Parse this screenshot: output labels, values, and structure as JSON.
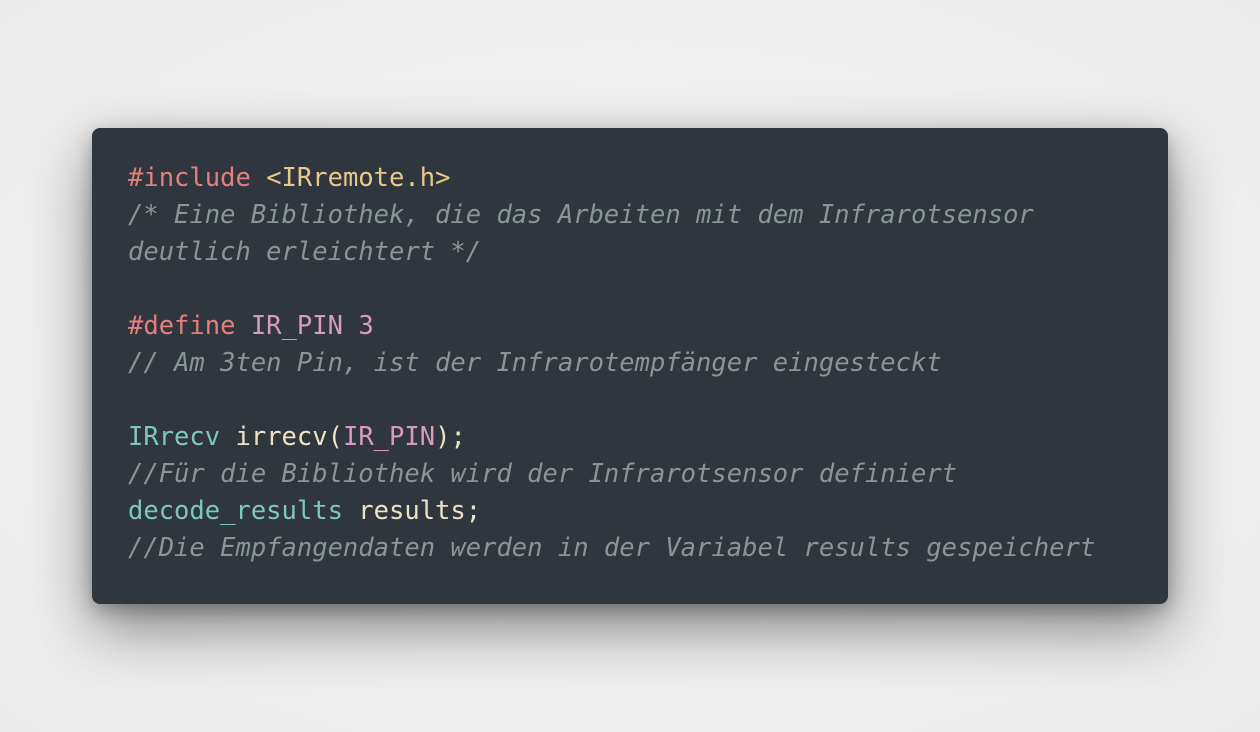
{
  "code": {
    "line1_include_kw": "#include",
    "line1_header": "<IRremote.h>",
    "line2_comment": "/* Eine Bibliothek, die das Arbeiten mit dem Infrarotsensor",
    "line3_comment": "deutlich erleichtert */",
    "line5_define_kw": "#define",
    "line5_macro": "IR_PIN",
    "line5_value": "3",
    "line6_comment": "// Am 3ten Pin, ist der Infrarotempfänger eingesteckt",
    "line8_type": "IRrecv",
    "line8_func": "irrecv",
    "line8_open": "(",
    "line8_arg": "IR_PIN",
    "line8_close": ");",
    "line9_comment": "//Für die Bibliothek wird der Infrarotsensor definiert",
    "line10_type": "decode_results",
    "line10_var": "results",
    "line10_end": ";",
    "line11_comment": "//Die Empfangendaten werden in der Variabel results gespeichert"
  },
  "colors": {
    "background": "#efefef",
    "card": "#2f363e",
    "keyword": "#e57f7f",
    "header": "#e9c98a",
    "macro": "#d99abf",
    "type": "#7fc6c0",
    "identifier": "#ece3c6",
    "comment": "#8a9696"
  }
}
